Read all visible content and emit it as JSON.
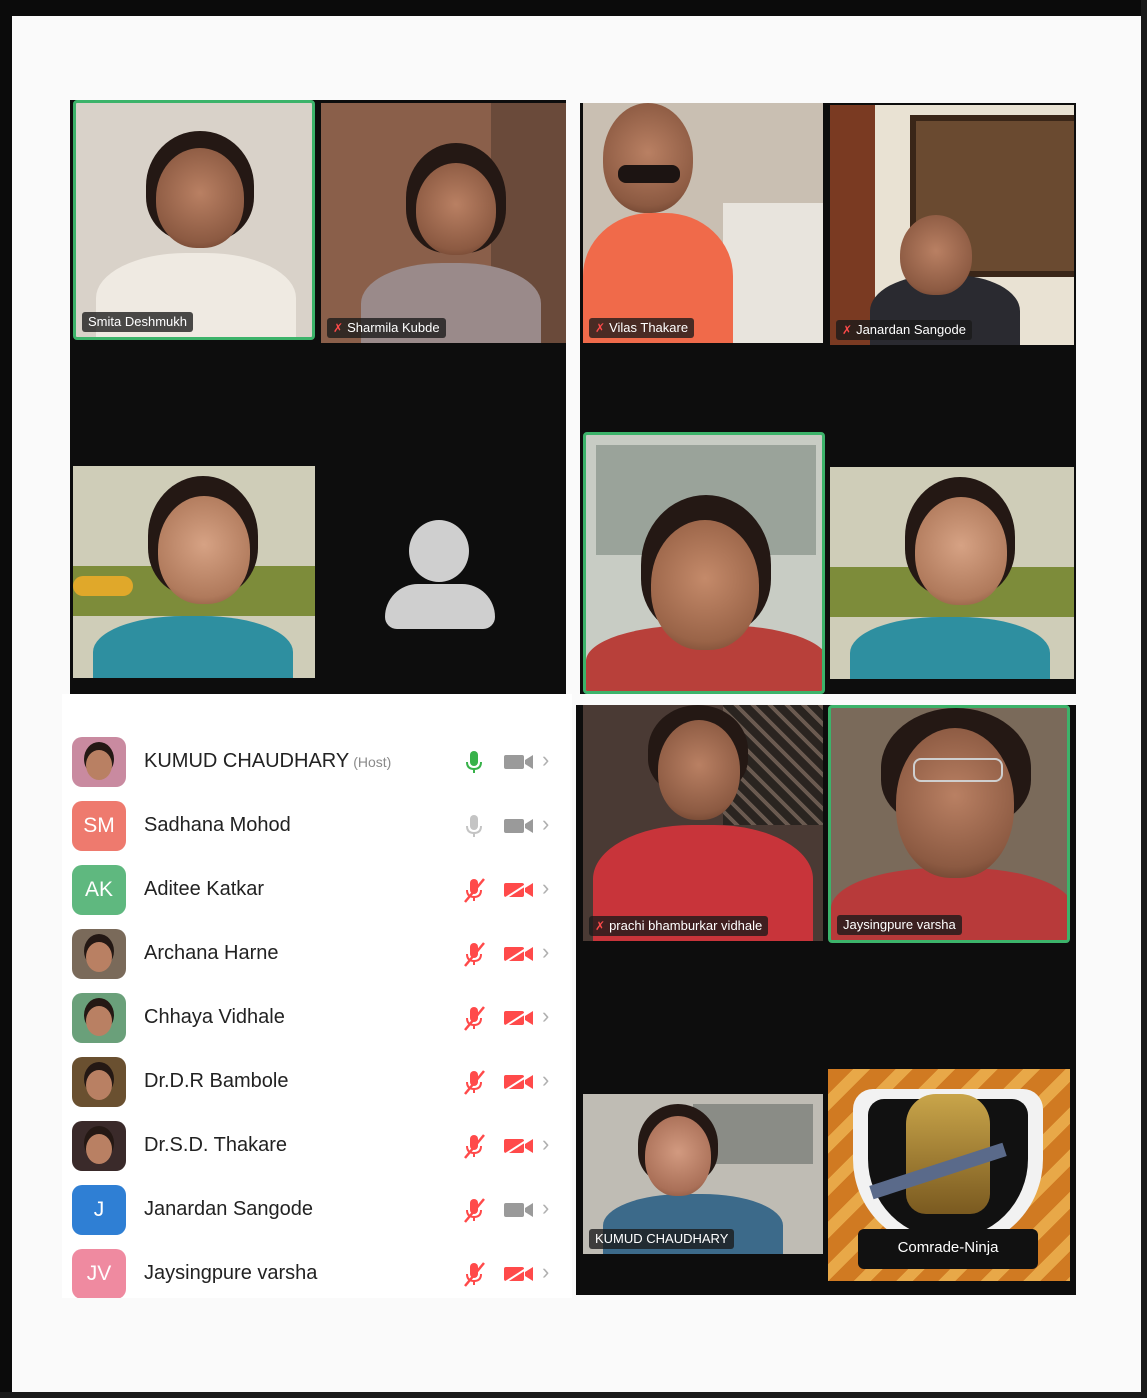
{
  "video_panels": {
    "panel_a_tiles": [
      {
        "name": "Smita Deshmukh",
        "muted": false,
        "active": true
      },
      {
        "name": "Sharmila Kubde",
        "muted": true,
        "active": false
      },
      {
        "name": "",
        "muted": false,
        "active": false
      },
      {
        "name": "",
        "muted": false,
        "active": false
      }
    ],
    "panel_b_tiles": [
      {
        "name": "Vilas Thakare",
        "muted": true,
        "active": false
      },
      {
        "name": "Janardan Sangode",
        "muted": true,
        "active": false
      },
      {
        "name": "",
        "muted": false,
        "active": true
      },
      {
        "name": "",
        "muted": false,
        "active": false
      }
    ],
    "panel_c_tiles": [
      {
        "name": "prachi bhamburkar vidhale",
        "muted": true,
        "active": false
      },
      {
        "name": "Jaysingpure varsha",
        "muted": false,
        "active": true
      },
      {
        "name": "KUMUD CHAUDHARY",
        "muted": false,
        "active": false
      },
      {
        "name": "",
        "muted": false,
        "active": false
      }
    ],
    "ninja_logo_text": "Comrade-Ninja"
  },
  "participants": {
    "host_label": "(Host)",
    "rows": [
      {
        "initials": "",
        "name": "KUMUD CHAUDHARY",
        "is_host": true,
        "mic": "on",
        "camera": "on",
        "avatar_color": "#c98aa0",
        "photo": true
      },
      {
        "initials": "SM",
        "name": "Sadhana Mohod",
        "is_host": false,
        "mic": "on-idle",
        "camera": "on",
        "avatar_color": "#ee7a6e",
        "photo": false
      },
      {
        "initials": "AK",
        "name": "Aditee Katkar",
        "is_host": false,
        "mic": "off",
        "camera": "off",
        "avatar_color": "#5fb87f",
        "photo": false
      },
      {
        "initials": "",
        "name": "Archana Harne",
        "is_host": false,
        "mic": "off",
        "camera": "off",
        "avatar_color": "#7a6a5a",
        "photo": true
      },
      {
        "initials": "",
        "name": "Chhaya Vidhale",
        "is_host": false,
        "mic": "off",
        "camera": "off",
        "avatar_color": "#6aa07a",
        "photo": true
      },
      {
        "initials": "",
        "name": "Dr.D.R Bambole",
        "is_host": false,
        "mic": "off",
        "camera": "off",
        "avatar_color": "#6a5030",
        "photo": true
      },
      {
        "initials": "",
        "name": "Dr.S.D. Thakare",
        "is_host": false,
        "mic": "off",
        "camera": "off",
        "avatar_color": "#3a2a2a",
        "photo": true
      },
      {
        "initials": "J",
        "name": "Janardan Sangode",
        "is_host": false,
        "mic": "off",
        "camera": "on",
        "avatar_color": "#2f7fd4",
        "photo": false
      },
      {
        "initials": "JV",
        "name": "Jaysingpure varsha",
        "is_host": false,
        "mic": "off",
        "camera": "off",
        "avatar_color": "#ef8aa0",
        "photo": false
      }
    ]
  },
  "colors": {
    "active_border": "#3cb36a",
    "mic_on": "#38b24a",
    "muted_red": "#ff4a4a"
  }
}
